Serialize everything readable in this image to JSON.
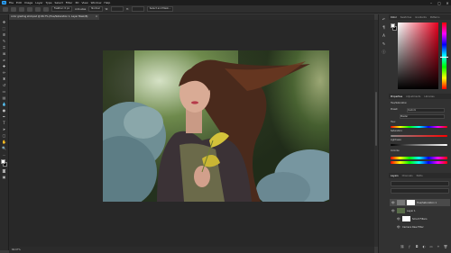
{
  "menubar": {
    "logo": "Ps",
    "items": [
      "File",
      "Edit",
      "Image",
      "Layer",
      "Type",
      "Select",
      "Filter",
      "3D",
      "View",
      "Window",
      "Help"
    ]
  },
  "window_controls": {
    "minimize": "–",
    "maximize": "▢",
    "close": "✕"
  },
  "options_bar": {
    "feather": "Feather: 0 px",
    "anti_alias": "Anti-alias",
    "style": "Normal",
    "width": "W:",
    "height": "H:",
    "select_mask": "Select and Mask..."
  },
  "document_tab": {
    "title": "color grading shot.psd @ 66.7% (Hue/Saturation 1, Layer Mask/8)",
    "close": "×"
  },
  "status_bar": {
    "zoom": "66.67%"
  },
  "panels": {
    "color_tabs": [
      "Color",
      "Swatches",
      "Gradients",
      "Patterns"
    ],
    "properties_tabs": [
      "Properties",
      "Adjustments",
      "Libraries"
    ],
    "properties_title": "Hue/Saturation",
    "preset_label": "Preset:",
    "preset_value": "Custom",
    "master_label": "Master",
    "hue_label": "Hue:",
    "saturation_label": "Saturation:",
    "lightness_label": "Lightness:",
    "colorize_label": "Colorize",
    "layers_tabs": [
      "Layers",
      "Channels",
      "Paths"
    ],
    "layers": [
      {
        "name": "Hue/Saturation 1"
      },
      {
        "name": "Layer 1"
      },
      {
        "name": "Smart Filters"
      },
      {
        "name": "Camera Raw Filter"
      }
    ]
  },
  "colors": {
    "accent": "#31a8ff",
    "foreground_swatch": "#ffffff",
    "background_swatch": "#000000"
  }
}
